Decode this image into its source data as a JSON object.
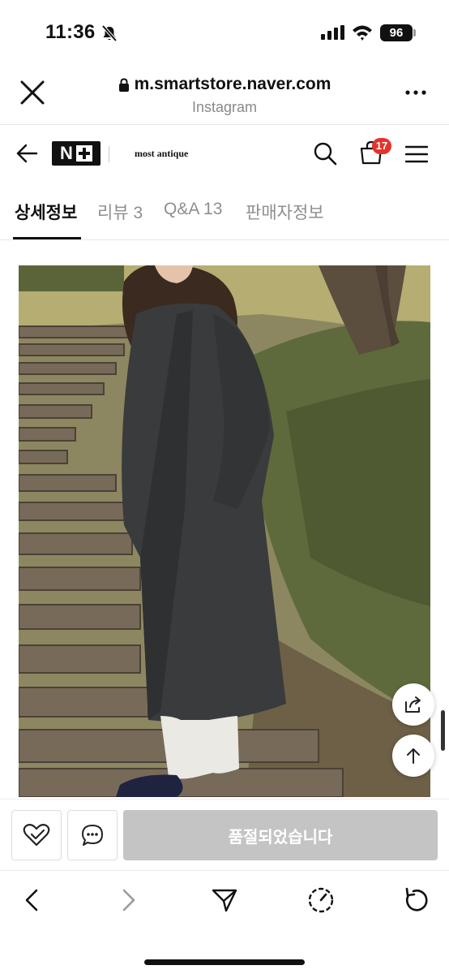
{
  "status_bar": {
    "time": "11:36",
    "battery": "96"
  },
  "browser": {
    "url": "m.smartstore.naver.com",
    "source": "Instagram"
  },
  "store": {
    "logo_text": "N",
    "name": "most antique",
    "cart_count": "17"
  },
  "tabs": [
    {
      "label": "상세정보",
      "active": true
    },
    {
      "label": "리뷰 3",
      "active": false
    },
    {
      "label": "Q&A 13",
      "active": false
    },
    {
      "label": "판매자정보",
      "active": false
    }
  ],
  "purchase": {
    "soldout_label": "품절되었습니다"
  },
  "colors": {
    "badge": "#e5322d",
    "soldout_bg": "#c4c4c4"
  }
}
